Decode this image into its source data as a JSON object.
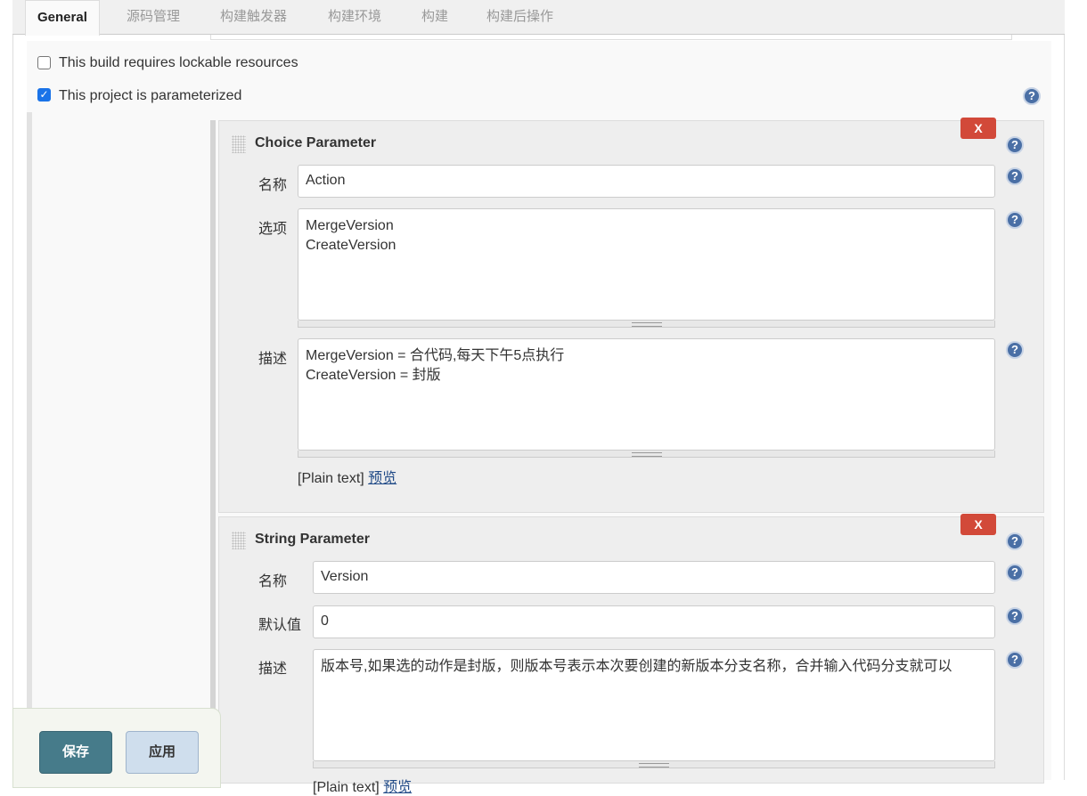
{
  "tabs": [
    "General",
    "源码管理",
    "构建触发器",
    "构建环境",
    "构建",
    "构建后操作"
  ],
  "options": {
    "lockable": "This build requires lockable resources",
    "parameterized": "This project is parameterized"
  },
  "choice": {
    "title": "Choice Parameter",
    "delete": "X",
    "name_label": "名称",
    "name": "Action",
    "choices_label": "选项",
    "choices": "MergeVersion\nCreateVersion",
    "desc_label": "描述",
    "desc": "MergeVersion = 合代码,每天下午5点执行\nCreateVersion = 封版",
    "plain": "[Plain text]",
    "preview": "预览"
  },
  "string": {
    "title": "String Parameter",
    "delete": "X",
    "name_label": "名称",
    "name": "Version",
    "default_label": "默认值",
    "default": "0",
    "desc_label": "描述",
    "desc": "版本号,如果选的动作是封版，则版本号表示本次要创建的新版本分支名称，合并输入代码分支就可以",
    "plain": "[Plain text]",
    "preview": "预览"
  },
  "buttons": {
    "save": "保存",
    "apply": "应用"
  },
  "help": "?"
}
